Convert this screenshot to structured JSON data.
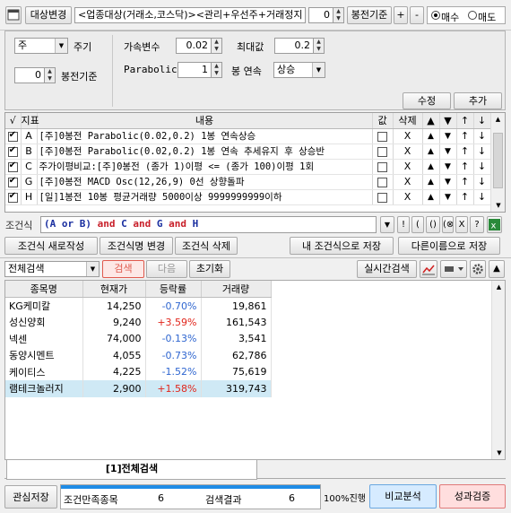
{
  "colors": {
    "up": "#e1251b",
    "down": "#2f66d0",
    "highlight_row": "#cfe9f5",
    "progress": "#1e8ce6",
    "search_tab": "#e05a4e"
  },
  "toolbar": {
    "target_change_label": "대상변경",
    "target_value": "<업종대상(거래소,코스닥)><관리+우선주+거래정지",
    "bong_count": "0",
    "bong_basis_label": "봉전기준",
    "plus_label": "+",
    "minus_label": "-",
    "buy_label": "매수",
    "sell_label": "매도"
  },
  "settings": {
    "period_value": "주",
    "period_label": "주기",
    "bong_value": "0",
    "bong_basis_label": "봉전기준",
    "accel_label": "가속변수",
    "accel_value": "0.02",
    "max_label": "최대값",
    "max_value": "0.2",
    "parabolic_label": "Parabolic",
    "parabolic_value": "1",
    "bong_consec_label": "봉 연속",
    "direction_value": "상승",
    "edit_button": "수정",
    "add_button": "추가"
  },
  "conditions": {
    "headers": {
      "check": "√",
      "indicator": "지표",
      "content": "내용",
      "value": "값",
      "delete": "삭제"
    },
    "rows": [
      {
        "id": "A",
        "content": "[주]0봉전 Parabolic(0.02,0.2) 1봉 연속상승",
        "delete": "X"
      },
      {
        "id": "B",
        "content": "[주]0봉전 Parabolic(0.02,0.2) 1봉 연속 추세유지 후 상승반",
        "delete": "X"
      },
      {
        "id": "C",
        "content": "주가이평비교:[주]0봉전 (종가 1)이평 <= (종가 100)이평 1회",
        "delete": "X"
      },
      {
        "id": "G",
        "content": "[주]0봉전 MACD Osc(12,26,9) 0선 상향돌파",
        "delete": "X"
      },
      {
        "id": "H",
        "content": "[일]1봉전 10봉 평균거래량 5000이상 9999999999이하",
        "delete": "X"
      }
    ]
  },
  "formula": {
    "label": "조건식",
    "tokens": [
      {
        "t": "(A or B)",
        "kind": "op"
      },
      {
        "t": " and ",
        "kind": "kw"
      },
      {
        "t": "C",
        "kind": "op"
      },
      {
        "t": " and ",
        "kind": "kw"
      },
      {
        "t": "G",
        "kind": "op"
      },
      {
        "t": " and ",
        "kind": "kw"
      },
      {
        "t": "H",
        "kind": "op"
      }
    ],
    "side_buttons": [
      "!",
      "(",
      "()",
      "(⊗)",
      "X",
      "?"
    ]
  },
  "actions": {
    "new": "조건식 새로작성",
    "rename": "조건식명 변경",
    "delete": "조건식 삭제",
    "save_mine": "내 조건식으로 저장",
    "save_as": "다른이름으로 저장"
  },
  "search": {
    "scope_value": "전체검색",
    "search_label": "검색",
    "next_label": "다음",
    "reset_label": "초기화",
    "realtime_label": "실시간검색"
  },
  "results": {
    "headers": [
      "종목명",
      "현재가",
      "등락률",
      "거래량"
    ],
    "rows": [
      {
        "name": "KG케미칼",
        "price": "14,250",
        "change": "-0.70%",
        "dir": "down",
        "volume": "19,861"
      },
      {
        "name": "성신양회",
        "price": "9,240",
        "change": "+3.59%",
        "dir": "up",
        "volume": "161,543"
      },
      {
        "name": "넥센",
        "price": "74,000",
        "change": "-0.13%",
        "dir": "down",
        "volume": "3,541"
      },
      {
        "name": "동양시멘트",
        "price": "4,055",
        "change": "-0.73%",
        "dir": "down",
        "volume": "62,786"
      },
      {
        "name": "케이티스",
        "price": "4,225",
        "change": "-1.52%",
        "dir": "down",
        "volume": "75,619"
      },
      {
        "name": "램테크놀러지",
        "price": "2,900",
        "change": "+1.58%",
        "dir": "up",
        "volume": "319,743"
      }
    ]
  },
  "tab": {
    "label": "[1]전체검색"
  },
  "footer": {
    "save_interest": "관심저장",
    "match_label": "조건만족종목",
    "match_count": "6",
    "result_label": "검색결과",
    "result_count": "6",
    "progress_text": "100%진행",
    "progress_value": 1.0,
    "compare_label": "비교분석",
    "performance_label": "성과검증"
  }
}
